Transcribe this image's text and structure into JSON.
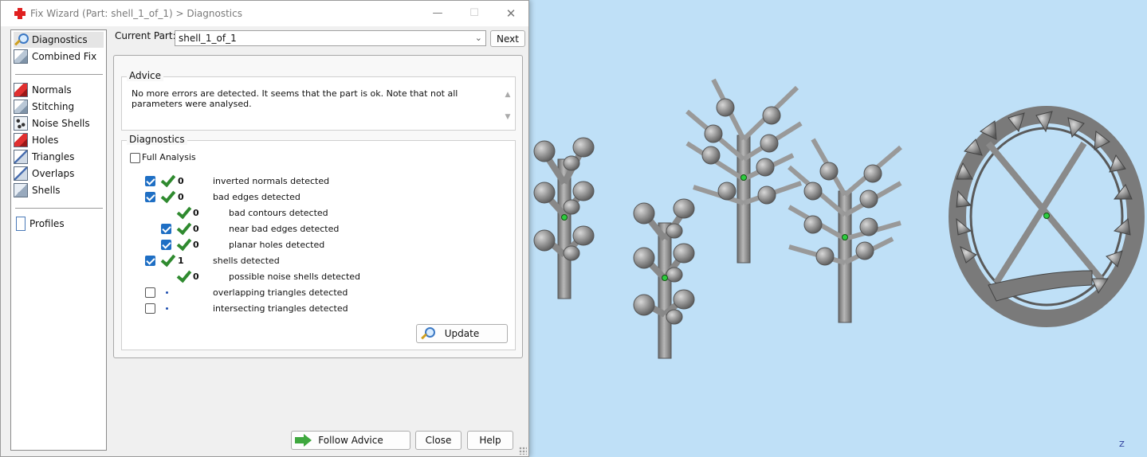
{
  "window": {
    "title": "Fix Wizard (Part: shell_1_of_1) > Diagnostics",
    "minimize_glyph": "—",
    "maximize_glyph": "☐",
    "close_glyph": "✕"
  },
  "nav": {
    "items": [
      {
        "label": "Diagnostics",
        "icon": "magnifier-icon",
        "selected": true
      },
      {
        "label": "Combined Fix",
        "icon": "cube-icon"
      },
      {
        "label": "Normals",
        "icon": "normals-icon"
      },
      {
        "label": "Stitching",
        "icon": "stitching-icon"
      },
      {
        "label": "Noise Shells",
        "icon": "noise-shells-icon"
      },
      {
        "label": "Holes",
        "icon": "holes-icon"
      },
      {
        "label": "Triangles",
        "icon": "triangles-icon"
      },
      {
        "label": "Overlaps",
        "icon": "overlaps-icon"
      },
      {
        "label": "Shells",
        "icon": "shells-icon"
      },
      {
        "label": "Profiles",
        "icon": "document-icon"
      }
    ]
  },
  "part_selector": {
    "label": "Current Part:",
    "value": "shell_1_of_1",
    "next_label": "Next"
  },
  "advice": {
    "title": "Advice",
    "text": "No more errors are detected. It seems that the part is ok. Note that not all parameters were analysed."
  },
  "diagnostics": {
    "title": "Diagnostics",
    "full_analysis_label": "Full Analysis",
    "full_analysis_checked": false,
    "rows": [
      {
        "checked": true,
        "status": "ok",
        "count": "0",
        "label": "inverted normals detected",
        "indent": 0
      },
      {
        "checked": true,
        "status": "ok",
        "count": "0",
        "label": "bad edges detected",
        "indent": 0
      },
      {
        "checked": null,
        "status": "ok",
        "count": "0",
        "label": "bad contours detected",
        "indent": 1
      },
      {
        "checked": true,
        "status": "ok",
        "count": "0",
        "label": "near bad edges detected",
        "indent": 1
      },
      {
        "checked": true,
        "status": "ok",
        "count": "0",
        "label": "planar holes detected",
        "indent": 1
      },
      {
        "checked": true,
        "status": "ok",
        "count": "1",
        "label": "shells detected",
        "indent": 0
      },
      {
        "checked": null,
        "status": "ok",
        "count": "0",
        "label": "possible noise shells detected",
        "indent": 1
      },
      {
        "checked": false,
        "status": "pending",
        "count": "",
        "label": "overlapping triangles detected",
        "indent": 0
      },
      {
        "checked": false,
        "status": "pending",
        "count": "",
        "label": "intersecting triangles detected",
        "indent": 0
      }
    ],
    "update_label": "Update"
  },
  "footer": {
    "follow_label": "Follow Advice",
    "close_label": "Close",
    "help_label": "Help"
  },
  "viewport": {
    "axis_label": "Z",
    "background": "#bfe0f7",
    "model_color": "#8c8c8c",
    "marker_color": "#2ecc40"
  }
}
